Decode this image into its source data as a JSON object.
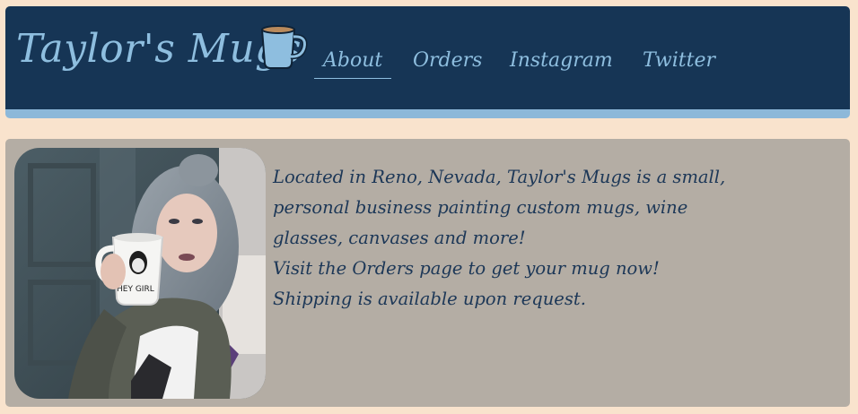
{
  "header": {
    "title": "Taylor's Mugs",
    "logo_icon": "coffee-mug-icon",
    "nav": [
      {
        "label": "About",
        "active": true
      },
      {
        "label": "Orders",
        "active": false
      },
      {
        "label": "Instagram",
        "active": false
      },
      {
        "label": "Twitter",
        "active": false
      }
    ]
  },
  "main": {
    "photo_alt": "Woman holding a white mug",
    "mug_print": "HEY GIRL",
    "paragraphs": [
      "Located in Reno, Nevada, Taylor's Mugs is a small, personal business painting custom mugs, wine glasses, canvases and more!",
      "Visit the Orders page to get your mug now! Shipping is available upon request."
    ]
  },
  "colors": {
    "page_bg": "#f9e3cd",
    "header_bg": "#163555",
    "accent": "#8ebedf",
    "content_bg": "#b4ada4",
    "text": "#1c3757"
  }
}
